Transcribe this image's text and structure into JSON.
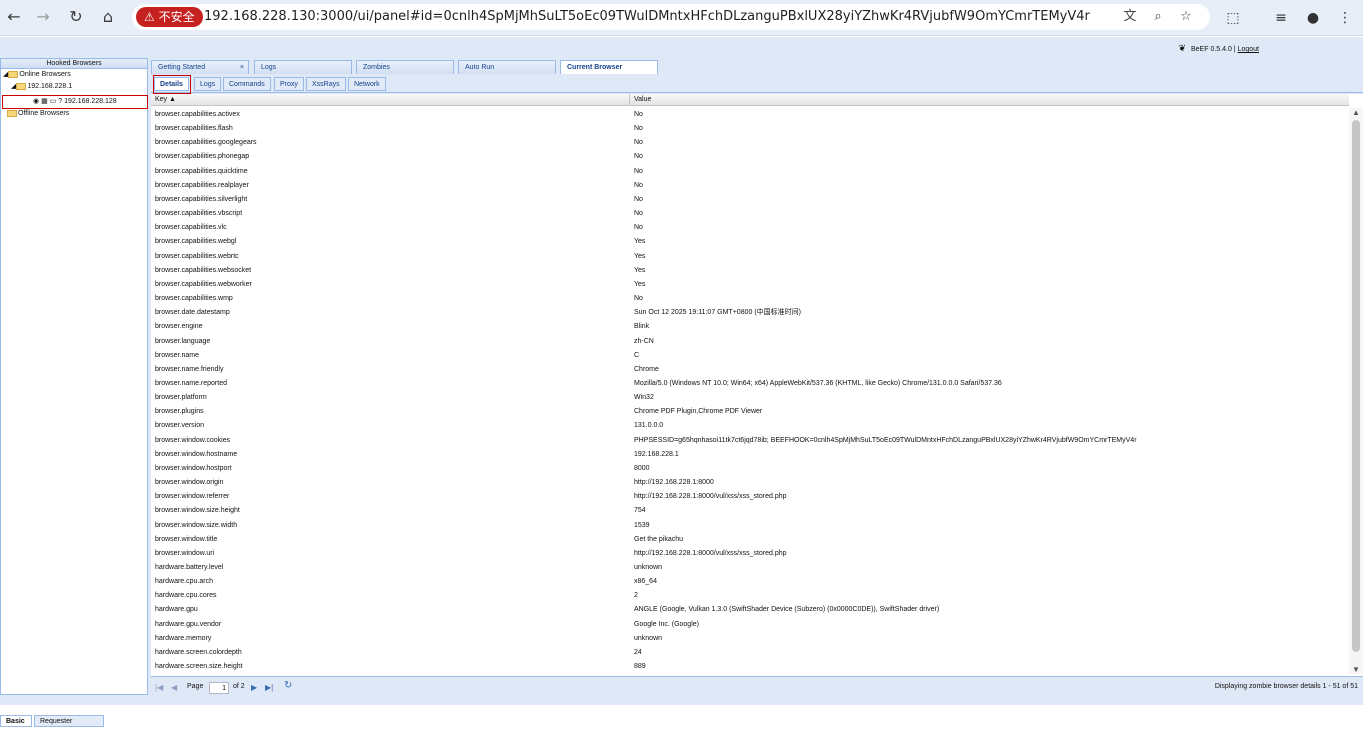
{
  "browser": {
    "warning": "⚠ 不安全",
    "url": "192.168.228.130:3000/ui/panel#id=0cnlh4SpMjMhSuLT5oEc09TWulDMntxHFchDLzanguPBxlUX28yiYZhwKr4RVjubfW9OmYCmrTEMyV4r"
  },
  "header": {
    "version": "BeEF  0.5.4.0  |",
    "logout": "Logout"
  },
  "left": {
    "title": "Hooked Browsers",
    "online": "Online Browsers",
    "subnet": "192.168.228.1",
    "host": "192.168.228.128",
    "offline": "Offline Browsers",
    "tabs": [
      "Basic",
      "Requester"
    ]
  },
  "main_tabs": [
    "Getting Started",
    "Logs",
    "Zombies",
    "Auto Run",
    "Current Browser"
  ],
  "sub_tabs": [
    "Details",
    "Logs",
    "Commands",
    "Proxy",
    "XssRays",
    "Network"
  ],
  "grid": {
    "col_key": "Key ▲",
    "col_value": "Value",
    "rows": [
      {
        "k": "browser.capabilities.activex",
        "v": "No"
      },
      {
        "k": "browser.capabilities.flash",
        "v": "No"
      },
      {
        "k": "browser.capabilities.googlegears",
        "v": "No"
      },
      {
        "k": "browser.capabilities.phonegap",
        "v": "No"
      },
      {
        "k": "browser.capabilities.quicktime",
        "v": "No"
      },
      {
        "k": "browser.capabilities.realplayer",
        "v": "No"
      },
      {
        "k": "browser.capabilities.silverlight",
        "v": "No"
      },
      {
        "k": "browser.capabilities.vbscript",
        "v": "No"
      },
      {
        "k": "browser.capabilities.vlc",
        "v": "No"
      },
      {
        "k": "browser.capabilities.webgl",
        "v": "Yes"
      },
      {
        "k": "browser.capabilities.webrtc",
        "v": "Yes"
      },
      {
        "k": "browser.capabilities.websocket",
        "v": "Yes"
      },
      {
        "k": "browser.capabilities.webworker",
        "v": "Yes"
      },
      {
        "k": "browser.capabilities.wmp",
        "v": "No"
      },
      {
        "k": "browser.date.datestamp",
        "v": "Sun Oct 12 2025 19:11:07 GMT+0800 (中国标准时间)"
      },
      {
        "k": "browser.engine",
        "v": "Blink"
      },
      {
        "k": "browser.language",
        "v": "zh-CN"
      },
      {
        "k": "browser.name",
        "v": "C"
      },
      {
        "k": "browser.name.friendly",
        "v": "Chrome"
      },
      {
        "k": "browser.name.reported",
        "v": "Mozilla/5.0 (Windows NT 10.0; Win64; x64) AppleWebKit/537.36 (KHTML, like Gecko) Chrome/131.0.0.0 Safari/537.36"
      },
      {
        "k": "browser.platform",
        "v": "Win32"
      },
      {
        "k": "browser.plugins",
        "v": "Chrome PDF Plugin,Chrome PDF Viewer"
      },
      {
        "k": "browser.version",
        "v": "131.0.0.0"
      },
      {
        "k": "browser.window.cookies",
        "v": "PHPSESSID=g65hqnhasoi11tk7ct6jqd78ib; BEEFHOOK=0cnlh4SpMjMhSuLT5oEc09TWulDMntxHFchDLzanguPBxlUX28yiYZhwKr4RVjubfW9OmYCmrTEMyV4r"
      },
      {
        "k": "browser.window.hostname",
        "v": "192.168.228.1"
      },
      {
        "k": "browser.window.hostport",
        "v": "8000"
      },
      {
        "k": "browser.window.origin",
        "v": "http://192.168.228.1:8000"
      },
      {
        "k": "browser.window.referrer",
        "v": "http://192.168.228.1:8000/vul/xss/xss_stored.php"
      },
      {
        "k": "browser.window.size.height",
        "v": "754"
      },
      {
        "k": "browser.window.size.width",
        "v": "1539"
      },
      {
        "k": "browser.window.title",
        "v": "Get the pikachu"
      },
      {
        "k": "browser.window.uri",
        "v": "http://192.168.228.1:8000/vul/xss/xss_stored.php"
      },
      {
        "k": "hardware.battery.level",
        "v": "unknown"
      },
      {
        "k": "hardware.cpu.arch",
        "v": "x86_64"
      },
      {
        "k": "hardware.cpu.cores",
        "v": "2"
      },
      {
        "k": "hardware.gpu",
        "v": "ANGLE (Google, Vulkan 1.3.0 (SwiftShader Device (Subzero) (0x0000C0DE)), SwiftShader driver)"
      },
      {
        "k": "hardware.gpu.vendor",
        "v": "Google Inc. (Google)"
      },
      {
        "k": "hardware.memory",
        "v": "unknown"
      },
      {
        "k": "hardware.screen.colordepth",
        "v": "24"
      },
      {
        "k": "hardware.screen.size.height",
        "v": "889"
      }
    ]
  },
  "pager": {
    "page_label": "Page",
    "page_value": "1",
    "of_label": "of 2",
    "status": "Displaying zombie browser details 1 - 51 of 51"
  }
}
